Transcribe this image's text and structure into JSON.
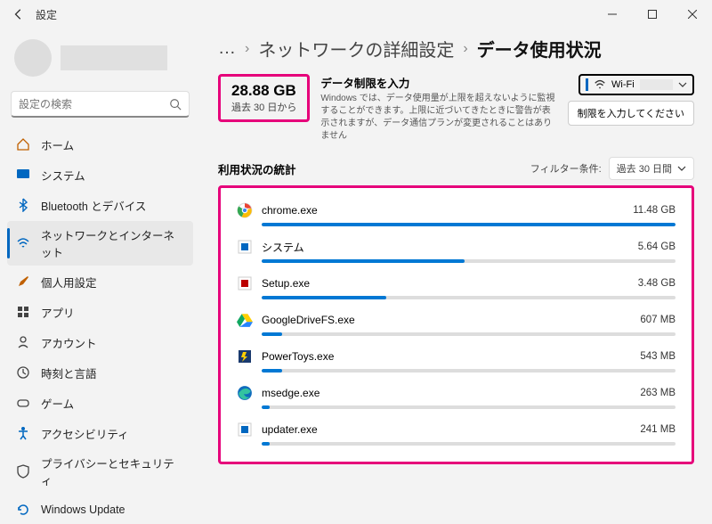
{
  "window": {
    "title": "設定"
  },
  "search": {
    "placeholder": "設定の検索"
  },
  "sidebar": {
    "items": [
      {
        "label": "ホーム"
      },
      {
        "label": "システム"
      },
      {
        "label": "Bluetooth とデバイス"
      },
      {
        "label": "ネットワークとインターネット"
      },
      {
        "label": "個人用設定"
      },
      {
        "label": "アプリ"
      },
      {
        "label": "アカウント"
      },
      {
        "label": "時刻と言語"
      },
      {
        "label": "ゲーム"
      },
      {
        "label": "アクセシビリティ"
      },
      {
        "label": "プライバシーとセキュリティ"
      },
      {
        "label": "Windows Update"
      }
    ]
  },
  "breadcrumb": {
    "more": "…",
    "parent": "ネットワークの詳細設定",
    "current": "データ使用状況"
  },
  "total": {
    "value": "28.88 GB",
    "label": "過去 30 日から"
  },
  "limit": {
    "title": "データ制限を入力",
    "desc": "Windows では、データ使用量が上限を超えないように監視することができます。上限に近づいてきたときに警告が表示されますが、データ通信プランが変更されることはありません",
    "button": "制限を入力してください"
  },
  "wifi": {
    "label": "Wi-Fi"
  },
  "stats": {
    "title": "利用状況の統計",
    "filter_label": "フィルター条件:",
    "filter_value": "過去 30 日間",
    "apps": [
      {
        "name": "chrome.exe",
        "value": "11.48 GB",
        "pct": 100,
        "icon": "chrome"
      },
      {
        "name": "システム",
        "value": "5.64 GB",
        "pct": 49,
        "icon": "system"
      },
      {
        "name": "Setup.exe",
        "value": "3.48 GB",
        "pct": 30,
        "icon": "setup"
      },
      {
        "name": "GoogleDriveFS.exe",
        "value": "607 MB",
        "pct": 5,
        "icon": "gdrive"
      },
      {
        "name": "PowerToys.exe",
        "value": "543 MB",
        "pct": 5,
        "icon": "powertoys"
      },
      {
        "name": "msedge.exe",
        "value": "263 MB",
        "pct": 2,
        "icon": "edge"
      },
      {
        "name": "updater.exe",
        "value": "241 MB",
        "pct": 2,
        "icon": "system"
      }
    ]
  }
}
